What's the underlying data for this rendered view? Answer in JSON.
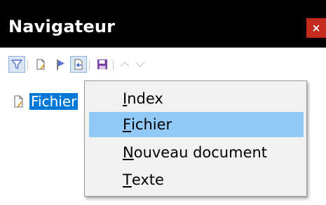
{
  "window": {
    "title": "Navigateur",
    "close_label": "×"
  },
  "toolbar": {
    "buttons": [
      {
        "name": "filter-icon",
        "state": "pressed"
      },
      {
        "name": "document-icon"
      },
      {
        "name": "flag-icon"
      },
      {
        "name": "insert-icon",
        "state": "pressed"
      },
      {
        "name": "save-icon"
      },
      {
        "name": "move-up-icon",
        "state": "disabled"
      },
      {
        "name": "move-down-icon",
        "state": "disabled"
      }
    ]
  },
  "tree": {
    "items": [
      {
        "label": "Fichier",
        "selected": true
      }
    ]
  },
  "menu": {
    "items": [
      {
        "mnemonic": "I",
        "rest": "ndex",
        "selected": false
      },
      {
        "mnemonic": "F",
        "rest": "ichier",
        "selected": true
      },
      {
        "mnemonic": "N",
        "rest": "ouveau document",
        "selected": false
      },
      {
        "mnemonic": "T",
        "rest": "exte",
        "selected": false
      }
    ]
  },
  "colors": {
    "titlebar": "#000000",
    "close_button": "#c42b1c",
    "selection": "#0078d7",
    "menu_highlight": "#91c9f7"
  }
}
